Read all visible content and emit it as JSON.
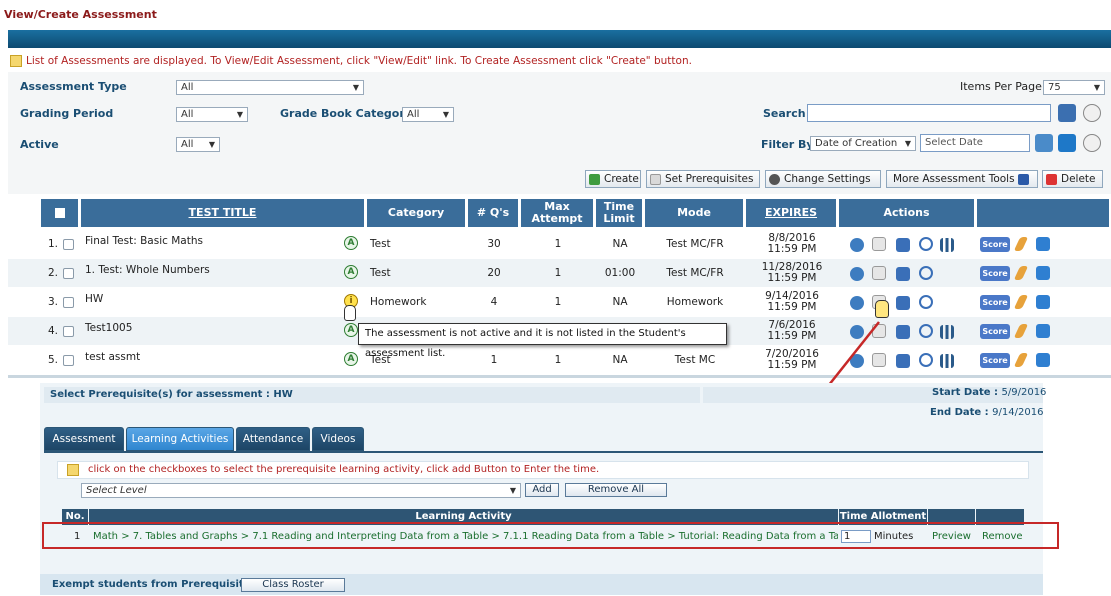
{
  "page_title": "View/Create Assessment",
  "info_text": "List of Assessments are displayed. To View/Edit Assessment, click \"View/Edit\" link. To Create Assessment click \"Create\" button.",
  "filters": {
    "assessment_type_label": "Assessment Type",
    "assessment_type_value": "All",
    "grading_period_label": "Grading Period",
    "grading_period_value": "All",
    "grade_book_category_label": "Grade Book Category",
    "grade_book_category_value": "All",
    "active_label": "Active",
    "active_value": "All",
    "items_per_page_label": "Items Per Page",
    "items_per_page_value": "75",
    "search_label": "Search",
    "search_value": "",
    "filter_by_label": "Filter By",
    "filter_by_value": "Date of Creation",
    "select_date_placeholder": "Select Date"
  },
  "toolbar": {
    "create": "Create",
    "set_prerequisites": "Set Prerequisites",
    "change_settings": "Change Settings",
    "more_tools": "More Assessment Tools",
    "delete": "Delete"
  },
  "grid": {
    "headers": [
      "TEST TITLE",
      "Category",
      "# Q's",
      "Max Attempt",
      "Time Limit",
      "Mode",
      "EXPIRES",
      "Actions"
    ],
    "header_max": "Max",
    "header_attempt": "Attempt",
    "header_time": "Time",
    "header_limit": "Limit",
    "rows": [
      {
        "num": "1.",
        "title": "Final Test: Basic Maths",
        "category": "Test",
        "qs": "30",
        "max": "1",
        "time": "NA",
        "mode": "Test MC/FR",
        "exp_date": "8/8/2016",
        "exp_time": "11:59 PM"
      },
      {
        "num": "2.",
        "title": "1. Test: Whole Numbers",
        "category": "Test",
        "qs": "20",
        "max": "1",
        "time": "01:00",
        "mode": "Test MC/FR",
        "exp_date": "11/28/2016",
        "exp_time": "11:59 PM"
      },
      {
        "num": "3.",
        "title": "HW",
        "category": "Homework",
        "qs": "4",
        "max": "1",
        "time": "NA",
        "mode": "Homework",
        "exp_date": "9/14/2016",
        "exp_time": "11:59 PM"
      },
      {
        "num": "4.",
        "title": "Test1005",
        "category": "",
        "qs": "",
        "max": "",
        "time": "",
        "mode": "",
        "exp_date": "7/6/2016",
        "exp_time": "11:59 PM"
      },
      {
        "num": "5.",
        "title": "test assmt",
        "category": "Test",
        "qs": "1",
        "max": "1",
        "time": "NA",
        "mode": "Test MC",
        "exp_date": "7/20/2016",
        "exp_time": "11:59 PM"
      }
    ],
    "score_label": "Score"
  },
  "tooltip": "The assessment is not active and it is not listed in the Student's assessment list.",
  "prereq": {
    "title": "Select Prerequisite(s) for assessment : HW",
    "start_label": "Start Date :",
    "start_value": "5/9/2016",
    "end_label": "End Date :",
    "end_value": "9/14/2016",
    "tabs": [
      "Assessment",
      "Learning Activities",
      "Attendance",
      "Videos"
    ],
    "note": "click on the checkboxes to select the prerequisite learning activity, click add Button to Enter the time.",
    "level_placeholder": "Select Level",
    "add_button": "Add",
    "remove_all_button": "Remove All",
    "col_no": "No.",
    "col_activity": "Learning Activity",
    "col_time": "Time Allotment",
    "row_no": "1",
    "row_activity": "Math > 7. Tables and Graphs > 7.1 Reading and Interpreting Data from a Table > 7.1.1 Reading Data from a Table > Tutorial: Reading Data from a Table",
    "row_time_value": "1",
    "row_minutes": "Minutes",
    "row_preview": "Preview",
    "row_remove": "Remove",
    "exempt_label": "Exempt students from Prerequisites",
    "class_roster_button": "Class Roster"
  },
  "colors": {
    "header_blue": "#3a6d9a",
    "title_red": "#8b1a1a",
    "link_green": "#1a6e2e",
    "highlight_red": "#c62828"
  }
}
